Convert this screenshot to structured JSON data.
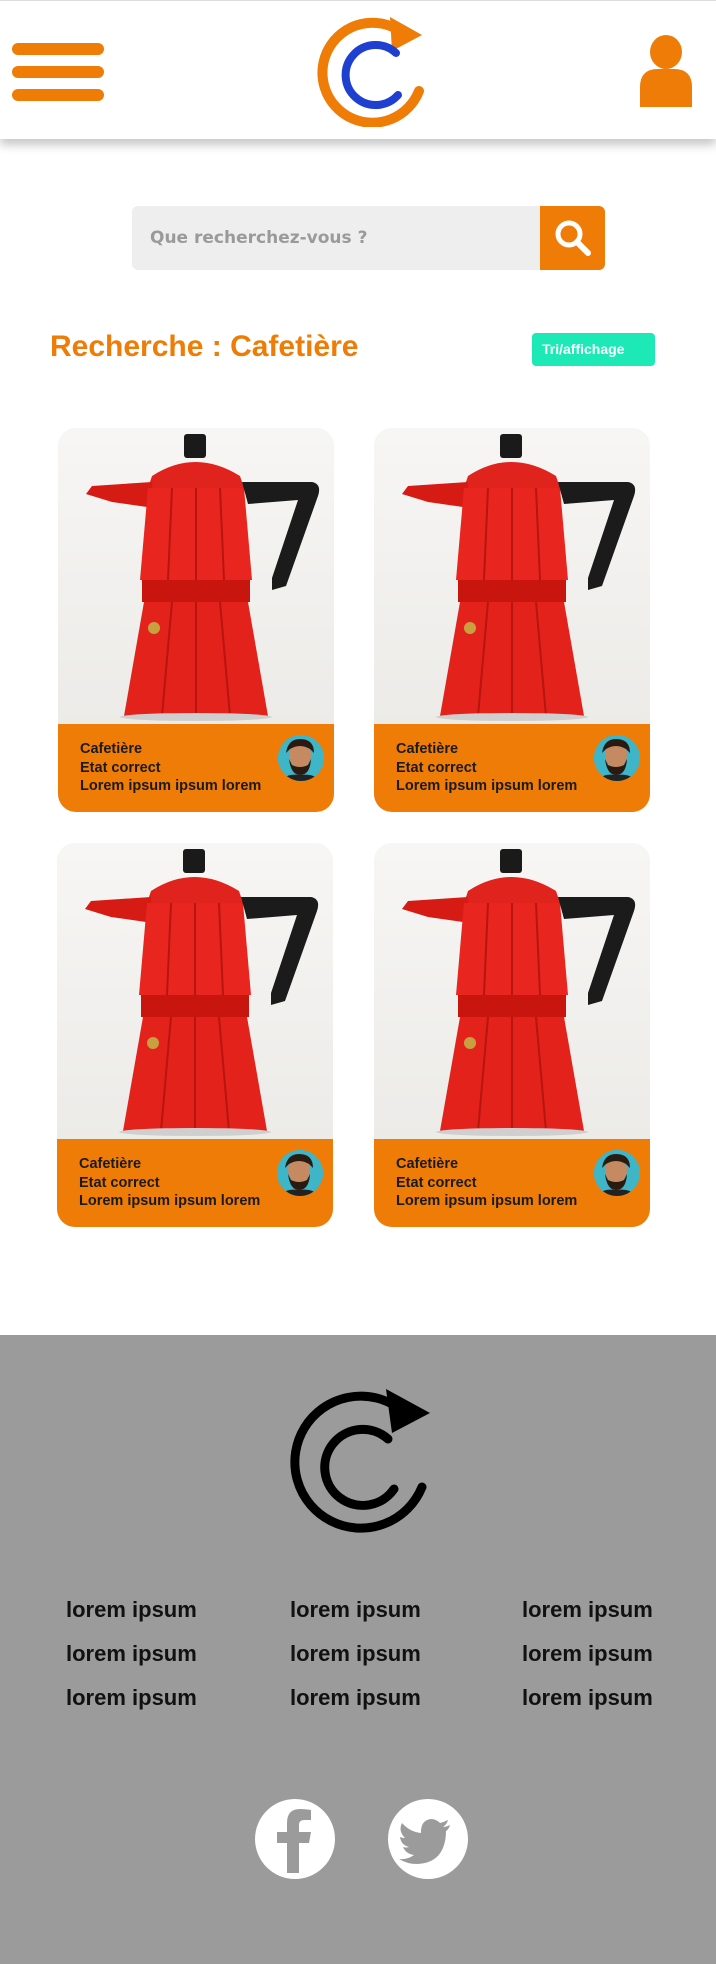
{
  "header": {
    "menu_icon": "hamburger-menu-icon",
    "logo_icon": "circular-arrow-c-logo",
    "user_icon": "user-profile-icon",
    "colors": {
      "accent": "#ee7c06",
      "logo_blue": "#1f3fd1"
    }
  },
  "search": {
    "placeholder": "Que recherchez-vous ?",
    "value": "",
    "button_icon": "search-icon"
  },
  "results": {
    "title": "Recherche : Cafetière",
    "sort_label": "Tri/affichage",
    "sort_color": "#1de9b6",
    "items": [
      {
        "name": "Cafetière",
        "condition": "Etat correct",
        "description": "Lorem ipsum ipsum lorem"
      },
      {
        "name": "Cafetière",
        "condition": "Etat correct",
        "description": "Lorem ipsum ipsum lorem"
      },
      {
        "name": "Cafetière",
        "condition": "Etat correct",
        "description": "Lorem ipsum ipsum lorem"
      },
      {
        "name": "Cafetière",
        "condition": "Etat correct",
        "description": "Lorem ipsum ipsum lorem"
      }
    ]
  },
  "footer": {
    "background": "#9b9b9b",
    "columns": [
      [
        "lorem ipsum",
        "lorem ipsum",
        "lorem ipsum"
      ],
      [
        "lorem ipsum",
        "lorem ipsum",
        "lorem ipsum"
      ],
      [
        "lorem ipsum",
        "lorem ipsum",
        "lorem ipsum"
      ]
    ],
    "social": [
      "facebook-icon",
      "twitter-icon"
    ]
  }
}
